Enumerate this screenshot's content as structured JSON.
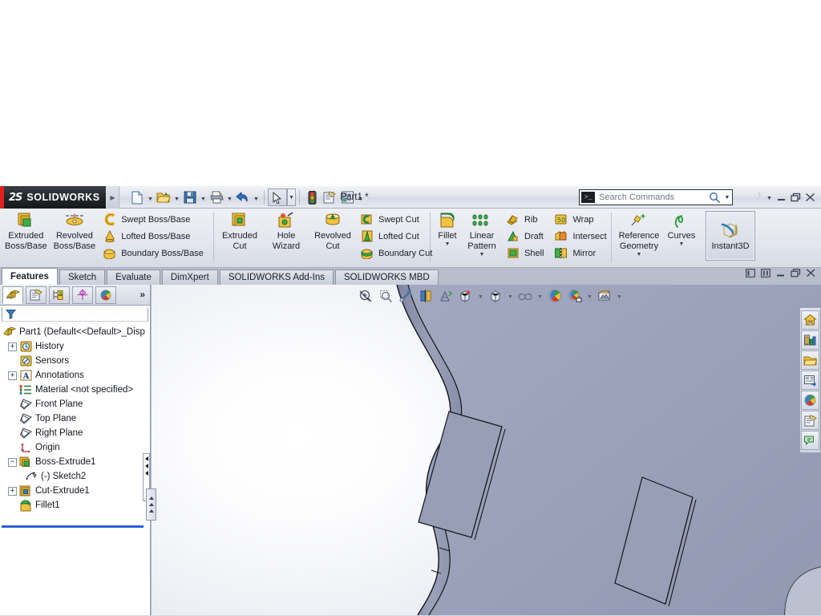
{
  "app": {
    "brand": "SOLIDWORKS",
    "brand_mark": "2S",
    "document_title": "Part1 *"
  },
  "titlebar": {
    "quick_access": [
      {
        "name": "new-document",
        "label": "New",
        "icon": "new-doc-icon",
        "has_dropdown": true
      },
      {
        "name": "open-document",
        "label": "Open",
        "icon": "open-folder-icon",
        "has_dropdown": true
      },
      {
        "name": "save-document",
        "label": "Save",
        "icon": "floppy-save-icon",
        "has_dropdown": true
      },
      {
        "name": "print-document",
        "label": "Print",
        "icon": "printer-icon",
        "has_dropdown": true
      },
      {
        "name": "undo",
        "label": "Undo",
        "icon": "undo-arrow-icon",
        "has_dropdown": true
      },
      {
        "name": "select",
        "label": "Select",
        "icon": "cursor-arrow-icon",
        "has_dropdown": true
      },
      {
        "name": "rebuild",
        "label": "Rebuild",
        "icon": "traffic-light-icon",
        "has_dropdown": false
      },
      {
        "name": "file-properties",
        "label": "File Properties",
        "icon": "properties-icon",
        "has_dropdown": false
      },
      {
        "name": "options",
        "label": "Options",
        "icon": "options-list-icon",
        "has_dropdown": true
      }
    ],
    "search": {
      "placeholder": "Search Commands",
      "value": "Search Commands",
      "icon": "magnifier-icon",
      "prefix_icon": "command-prompt-icon"
    },
    "help_label": "?",
    "window_buttons": [
      "minimize",
      "restore",
      "close"
    ]
  },
  "ribbon": {
    "groups": [
      {
        "name": "boss-base-group",
        "large": [
          {
            "label_line1": "Extruded",
            "label_line2": "Boss/Base",
            "icon": "extruded-boss-icon",
            "caret": false
          },
          {
            "label_line1": "Revolved",
            "label_line2": "Boss/Base",
            "icon": "revolved-boss-icon",
            "caret": false
          }
        ],
        "small": [
          {
            "label": "Swept Boss/Base",
            "icon": "swept-boss-icon"
          },
          {
            "label": "Lofted Boss/Base",
            "icon": "lofted-boss-icon"
          },
          {
            "label": "Boundary Boss/Base",
            "icon": "boundary-boss-icon"
          }
        ]
      },
      {
        "name": "cut-group",
        "large": [
          {
            "label_line1": "Extruded",
            "label_line2": "Cut",
            "icon": "extruded-cut-icon",
            "caret": false
          },
          {
            "label_line1": "Hole",
            "label_line2": "Wizard",
            "icon": "hole-wizard-icon",
            "caret": false
          },
          {
            "label_line1": "Revolved",
            "label_line2": "Cut",
            "icon": "revolved-cut-icon",
            "caret": false
          }
        ],
        "small": [
          {
            "label": "Swept Cut",
            "icon": "swept-cut-icon"
          },
          {
            "label": "Lofted Cut",
            "icon": "lofted-cut-icon"
          },
          {
            "label": "Boundary Cut",
            "icon": "boundary-cut-icon"
          }
        ]
      },
      {
        "name": "features-group",
        "large": [
          {
            "label_line1": "Fillet",
            "label_line2": "",
            "icon": "fillet-icon",
            "caret": true
          },
          {
            "label_line1": "Linear",
            "label_line2": "Pattern",
            "icon": "linear-pattern-icon",
            "caret": true
          }
        ],
        "small": [
          {
            "label": "Rib",
            "icon": "rib-icon"
          },
          {
            "label": "Draft",
            "icon": "draft-icon"
          },
          {
            "label": "Shell",
            "icon": "shell-icon"
          }
        ],
        "small2": [
          {
            "label": "Wrap",
            "icon": "wrap-icon"
          },
          {
            "label": "Intersect",
            "icon": "intersect-icon"
          },
          {
            "label": "Mirror",
            "icon": "mirror-icon"
          }
        ]
      },
      {
        "name": "geometry-group",
        "large": [
          {
            "label_line1": "Reference",
            "label_line2": "Geometry",
            "icon": "reference-geometry-icon",
            "caret": true
          },
          {
            "label_line1": "Curves",
            "label_line2": "",
            "icon": "curves-icon",
            "caret": true
          }
        ],
        "small": []
      }
    ],
    "instant3d": {
      "label": "Instant3D",
      "icon": "instant3d-icon",
      "active": true
    }
  },
  "command_tabs": {
    "active": "Features",
    "items": [
      {
        "label": "Features"
      },
      {
        "label": "Sketch"
      },
      {
        "label": "Evaluate"
      },
      {
        "label": "DimXpert"
      },
      {
        "label": "SOLIDWORKS Add-Ins"
      },
      {
        "label": "SOLIDWORKS MBD"
      }
    ]
  },
  "feature_manager": {
    "tabs": [
      {
        "name": "feature-manager-tab",
        "icon": "feature-tree-icon",
        "active": true
      },
      {
        "name": "property-manager-tab",
        "icon": "property-manager-icon",
        "active": false
      },
      {
        "name": "configuration-manager-tab",
        "icon": "configuration-manager-icon",
        "active": false
      },
      {
        "name": "dimxpert-manager-tab",
        "icon": "dimxpert-manager-icon",
        "active": false
      },
      {
        "name": "display-manager-tab",
        "icon": "display-manager-icon",
        "active": false
      }
    ],
    "expand_chevron": "»",
    "filter": {
      "icon": "filter-funnel-icon",
      "value": "",
      "placeholder": ""
    },
    "tree": [
      {
        "label": "Part1  (Default<<Default>_Disp",
        "icon": "part-icon",
        "indent": 0,
        "expander": "none",
        "root": true
      },
      {
        "label": "History",
        "icon": "history-icon",
        "indent": 1,
        "expander": "plus"
      },
      {
        "label": "Sensors",
        "icon": "sensors-icon",
        "indent": 1,
        "expander": "none"
      },
      {
        "label": "Annotations",
        "icon": "annotations-icon",
        "indent": 1,
        "expander": "plus"
      },
      {
        "label": "Material <not specified>",
        "icon": "material-icon",
        "indent": 1,
        "expander": "none"
      },
      {
        "label": "Front Plane",
        "icon": "plane-icon",
        "indent": 1,
        "expander": "none"
      },
      {
        "label": "Top Plane",
        "icon": "plane-icon",
        "indent": 1,
        "expander": "none"
      },
      {
        "label": "Right Plane",
        "icon": "plane-icon",
        "indent": 1,
        "expander": "none"
      },
      {
        "label": "Origin",
        "icon": "origin-icon",
        "indent": 1,
        "expander": "none"
      },
      {
        "label": "Boss-Extrude1",
        "icon": "boss-extrude-icon",
        "indent": 1,
        "expander": "minus"
      },
      {
        "label": "(-) Sketch2",
        "icon": "sketch-icon",
        "indent": 2,
        "expander": "none"
      },
      {
        "label": "Cut-Extrude1",
        "icon": "cut-extrude-icon",
        "indent": 1,
        "expander": "plus"
      },
      {
        "label": "Fillet1",
        "icon": "fillet-feature-icon",
        "indent": 1,
        "expander": "none"
      }
    ],
    "rollback_bar": true
  },
  "viewport": {
    "heads_up_toolbar": [
      {
        "name": "zoom-to-fit",
        "icon": "zoom-to-fit-icon",
        "dropdown": false
      },
      {
        "name": "zoom-to-area",
        "icon": "zoom-to-area-icon",
        "dropdown": false
      },
      {
        "name": "previous-view",
        "icon": "previous-view-icon",
        "dropdown": false
      },
      {
        "name": "section-view",
        "icon": "section-view-icon",
        "dropdown": false
      },
      {
        "name": "view-orientation",
        "icon": "view-orientation-icon",
        "dropdown": false
      },
      {
        "name": "display-style",
        "icon": "display-style-icon",
        "dropdown": true
      },
      {
        "name": "hide-show-items",
        "icon": "hide-show-items-icon",
        "dropdown": true
      },
      {
        "name": "edit-appearance",
        "icon": "edit-appearance-icon",
        "dropdown": true
      },
      {
        "name": "apply-scene",
        "icon": "apply-scene-icon",
        "dropdown": true
      },
      {
        "name": "view-settings",
        "icon": "view-settings-icon",
        "dropdown": true
      }
    ],
    "window_buttons": [
      {
        "name": "restore-down-left",
        "icon": "restore-left-icon"
      },
      {
        "name": "restore-down-right",
        "icon": "restore-right-icon"
      },
      {
        "name": "minimize-document",
        "icon": "minimize-icon"
      },
      {
        "name": "restore-document",
        "icon": "restore-icon"
      },
      {
        "name": "close-document",
        "icon": "close-icon"
      }
    ],
    "model": {
      "part_color": "#9aa0b8",
      "edge_color": "#14161c",
      "background_top": "#ffffff",
      "background_bottom": "#ced4e1",
      "description": "Shaded curved sheet-metal-like part with wavy left edge and two rectangular slot cutouts"
    },
    "task_pane": [
      {
        "name": "solidworks-resources",
        "icon": "home-resources-icon"
      },
      {
        "name": "design-library",
        "icon": "design-library-icon"
      },
      {
        "name": "file-explorer",
        "icon": "file-explorer-icon"
      },
      {
        "name": "view-palette",
        "icon": "view-palette-icon"
      },
      {
        "name": "appearances-scenes-decals",
        "icon": "appearances-icon"
      },
      {
        "name": "custom-properties",
        "icon": "custom-properties-icon"
      },
      {
        "name": "solidworks-forum",
        "icon": "forum-icon"
      }
    ]
  }
}
